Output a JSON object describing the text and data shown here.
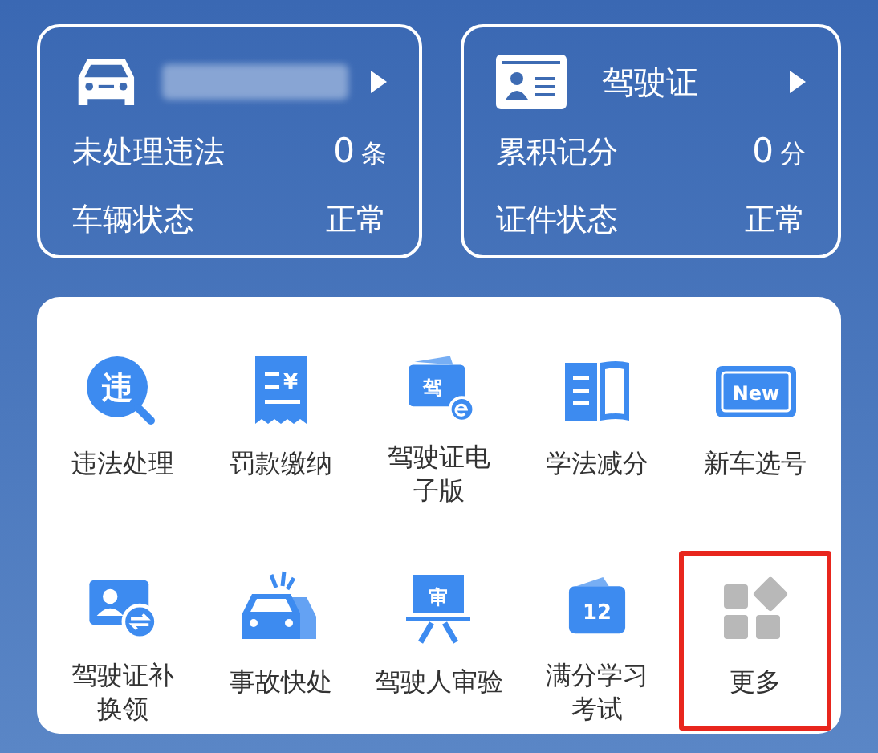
{
  "vehicle_card": {
    "plate_redacted": true,
    "rows": [
      {
        "label": "未处理违法",
        "value": "0",
        "unit": "条"
      },
      {
        "label": "车辆状态",
        "value": "正常"
      }
    ]
  },
  "license_card": {
    "title": "驾驶证",
    "rows": [
      {
        "label": "累积记分",
        "value": "0",
        "unit": "分"
      },
      {
        "label": "证件状态",
        "value": "正常"
      }
    ]
  },
  "services": [
    {
      "kind": "search",
      "icon_text": "违",
      "label": "违法处理",
      "highlighted": false
    },
    {
      "kind": "receipt",
      "icon_text": "¥",
      "label": "罚款缴纳",
      "highlighted": false
    },
    {
      "kind": "elicense",
      "icon_text": "驾",
      "label": [
        "驾驶证电",
        "子版"
      ],
      "highlighted": false
    },
    {
      "kind": "book",
      "label": "学法减分",
      "highlighted": false
    },
    {
      "kind": "plate",
      "icon_text": "New",
      "label": "新车选号",
      "highlighted": false
    },
    {
      "kind": "idswap",
      "label": [
        "驾驶证补",
        "换领"
      ],
      "highlighted": false
    },
    {
      "kind": "crash",
      "label": "事故快处",
      "highlighted": false
    },
    {
      "kind": "easel",
      "icon_text": "审",
      "label": "驾驶人审验",
      "highlighted": false
    },
    {
      "kind": "calendar",
      "icon_text": "12",
      "label": [
        "满分学习",
        "考试"
      ],
      "highlighted": false
    },
    {
      "kind": "more",
      "label": "更多",
      "highlighted": true
    }
  ]
}
